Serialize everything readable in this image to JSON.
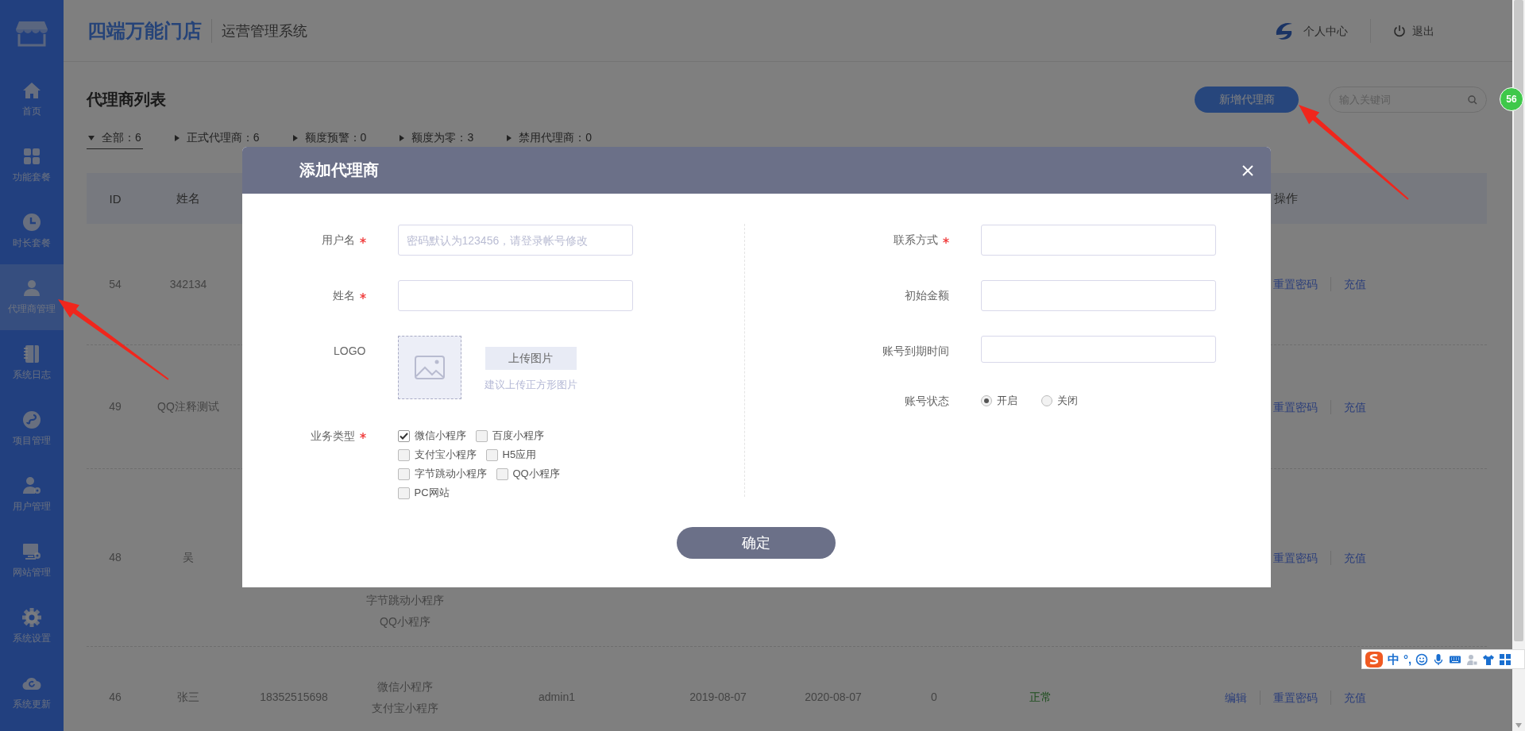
{
  "sidebar": {
    "items": [
      {
        "label": "首页",
        "selected": false
      },
      {
        "label": "功能套餐",
        "selected": false
      },
      {
        "label": "时长套餐",
        "selected": false
      },
      {
        "label": "代理商管理",
        "selected": true
      },
      {
        "label": "系统日志",
        "selected": false
      },
      {
        "label": "项目管理",
        "selected": false
      },
      {
        "label": "用户管理",
        "selected": false
      },
      {
        "label": "网站管理",
        "selected": false
      },
      {
        "label": "系统设置",
        "selected": false
      },
      {
        "label": "系统更新",
        "selected": false
      }
    ]
  },
  "header": {
    "brand": "四端万能门店",
    "subtitle": "运营管理系统",
    "profile": "个人中心",
    "logout": "退出"
  },
  "page": {
    "title": "代理商列表",
    "add_button": "新增代理商",
    "search": {
      "placeholder": "输入关键词"
    },
    "filters": [
      {
        "label": "全部：6",
        "selected": true
      },
      {
        "label": "正式代理商：6",
        "selected": false
      },
      {
        "label": "额度预警：0",
        "selected": false
      },
      {
        "label": "额度为零：3",
        "selected": false
      },
      {
        "label": "禁用代理商：0",
        "selected": false
      }
    ]
  },
  "table": {
    "columns": [
      "ID",
      "姓名",
      "操作"
    ],
    "rows": [
      {
        "id": "54",
        "name": "342134",
        "actions": [
          "重置密码",
          "充值"
        ]
      },
      {
        "id": "49",
        "name": "QQ注释测试",
        "actions": [
          "重置密码",
          "充值"
        ]
      },
      {
        "id": "48",
        "name": "吴",
        "business": [
          "字节跳动小程序",
          "QQ小程序"
        ],
        "actions": [
          "重置密码",
          "充值"
        ]
      },
      {
        "id": "46",
        "name": "张三",
        "phone": "18352515698",
        "business": [
          "微信小程序",
          "支付宝小程序"
        ],
        "admin": "admin1",
        "created": "2019-08-07",
        "expires": "2020-08-07",
        "amount": "0",
        "status": "正常",
        "actions": [
          "编辑",
          "重置密码",
          "充值"
        ]
      }
    ]
  },
  "dialog": {
    "title": "添加代理商",
    "left_fields": [
      {
        "kind": "text",
        "label": "用户名",
        "required": true,
        "placeholder": "密码默认为123456，请登录帐号修改"
      },
      {
        "kind": "text",
        "label": "姓名",
        "required": true
      },
      {
        "kind": "image",
        "label": "LOGO",
        "required": false,
        "button": "上传图片",
        "hint": "建议上传正方形图片"
      },
      {
        "kind": "checkboxes",
        "label": "业务类型",
        "required": true,
        "options": [
          {
            "label": "微信小程序",
            "checked": true
          },
          {
            "label": "百度小程序",
            "checked": false
          },
          {
            "label": "支付宝小程序",
            "checked": false
          },
          {
            "label": "H5应用",
            "checked": false
          },
          {
            "label": "字节跳动小程序",
            "checked": false
          },
          {
            "label": "QQ小程序",
            "checked": false
          },
          {
            "label": "PC网站",
            "checked": false
          }
        ]
      }
    ],
    "right_fields": [
      {
        "kind": "text",
        "label": "联系方式",
        "required": true
      },
      {
        "kind": "text",
        "label": "初始金额",
        "required": false
      },
      {
        "kind": "text",
        "label": "账号到期时间",
        "required": false
      },
      {
        "kind": "radio",
        "label": "账号状态",
        "required": false,
        "options": [
          {
            "label": "开启",
            "selected": true
          },
          {
            "label": "关闭",
            "selected": false
          }
        ]
      }
    ],
    "confirm": "确定"
  },
  "ime_toolbar": {
    "mode": "中",
    "punctuation": "°,"
  },
  "badge": {
    "text": "56"
  }
}
